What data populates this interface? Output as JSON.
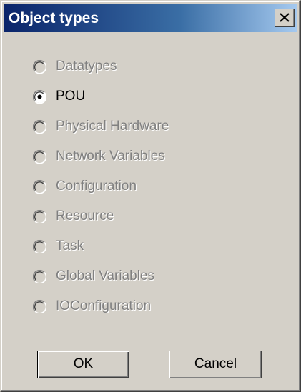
{
  "dialog": {
    "title": "Object types",
    "close_icon": "close-x-icon"
  },
  "options": [
    {
      "label": "Datatypes",
      "enabled": false,
      "selected": false
    },
    {
      "label": "POU",
      "enabled": true,
      "selected": true
    },
    {
      "label": "Physical Hardware",
      "enabled": false,
      "selected": false
    },
    {
      "label": "Network Variables",
      "enabled": false,
      "selected": false
    },
    {
      "label": "Configuration",
      "enabled": false,
      "selected": false
    },
    {
      "label": "Resource",
      "enabled": false,
      "selected": false
    },
    {
      "label": "Task",
      "enabled": false,
      "selected": false
    },
    {
      "label": "Global Variables",
      "enabled": false,
      "selected": false
    },
    {
      "label": "IOConfiguration",
      "enabled": false,
      "selected": false
    }
  ],
  "buttons": {
    "ok_label": "OK",
    "cancel_label": "Cancel"
  },
  "colors": {
    "titlebar_start": "#0a246a",
    "titlebar_end": "#a6caf0",
    "face": "#d4d0c8",
    "disabled_text": "#808080"
  }
}
